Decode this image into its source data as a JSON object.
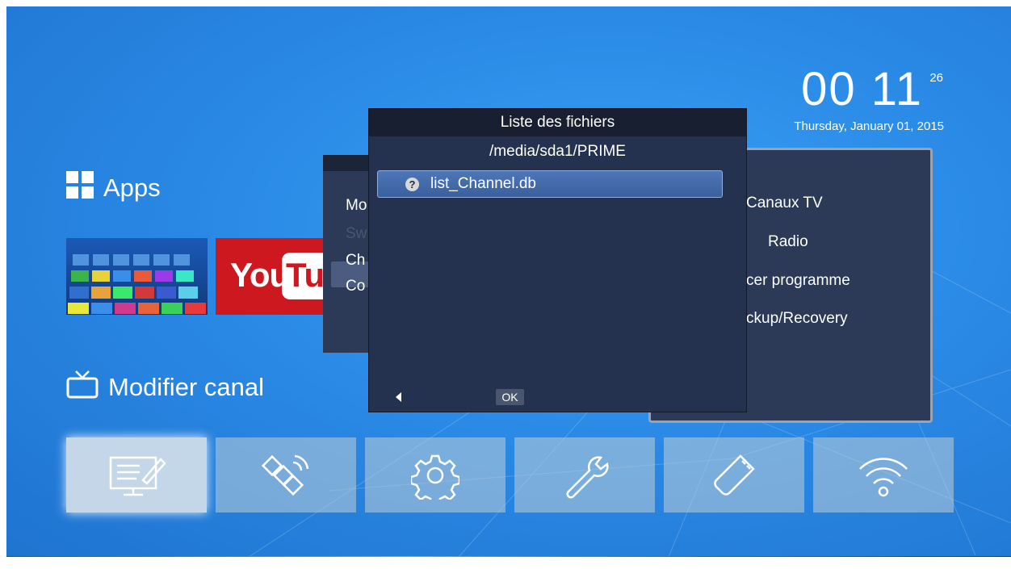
{
  "clock": {
    "time": "00 11",
    "seconds": "26",
    "date": "Thursday, January 01, 2015"
  },
  "sections": {
    "apps_title": "Apps",
    "modifier_title": "Modifier canal"
  },
  "apps_tiles": [
    {
      "name": "apps-store",
      "icon": "app-grid-icon"
    },
    {
      "name": "youtube",
      "text_left": "You",
      "text_box": "Tub"
    }
  ],
  "bottom_bar": [
    {
      "icon": "edit-list-icon",
      "selected": true
    },
    {
      "icon": "satellite-icon",
      "selected": false
    },
    {
      "icon": "gear-icon",
      "selected": false
    },
    {
      "icon": "wrench-icon",
      "selected": false
    },
    {
      "icon": "usb-icon",
      "selected": false
    },
    {
      "icon": "wifi-icon",
      "selected": false
    }
  ],
  "back_menu_left": [
    "Mo",
    "Sw",
    "Ch",
    "Co"
  ],
  "back_menu_right": [
    "Canaux TV",
    "Radio",
    "cer programme",
    "ckup/Recovery"
  ],
  "dialog": {
    "title": "Liste des fichiers",
    "path": "/media/sda1/PRIME",
    "files": [
      {
        "icon": "question-icon",
        "icon_glyph": "?",
        "name": "list_Channel.db"
      }
    ],
    "ok_label": "OK"
  },
  "colors": {
    "background": "#2a8ae6",
    "dialog_bg": "#25324f",
    "selection": "#4d77b8",
    "youtube_red": "#cc181e"
  }
}
